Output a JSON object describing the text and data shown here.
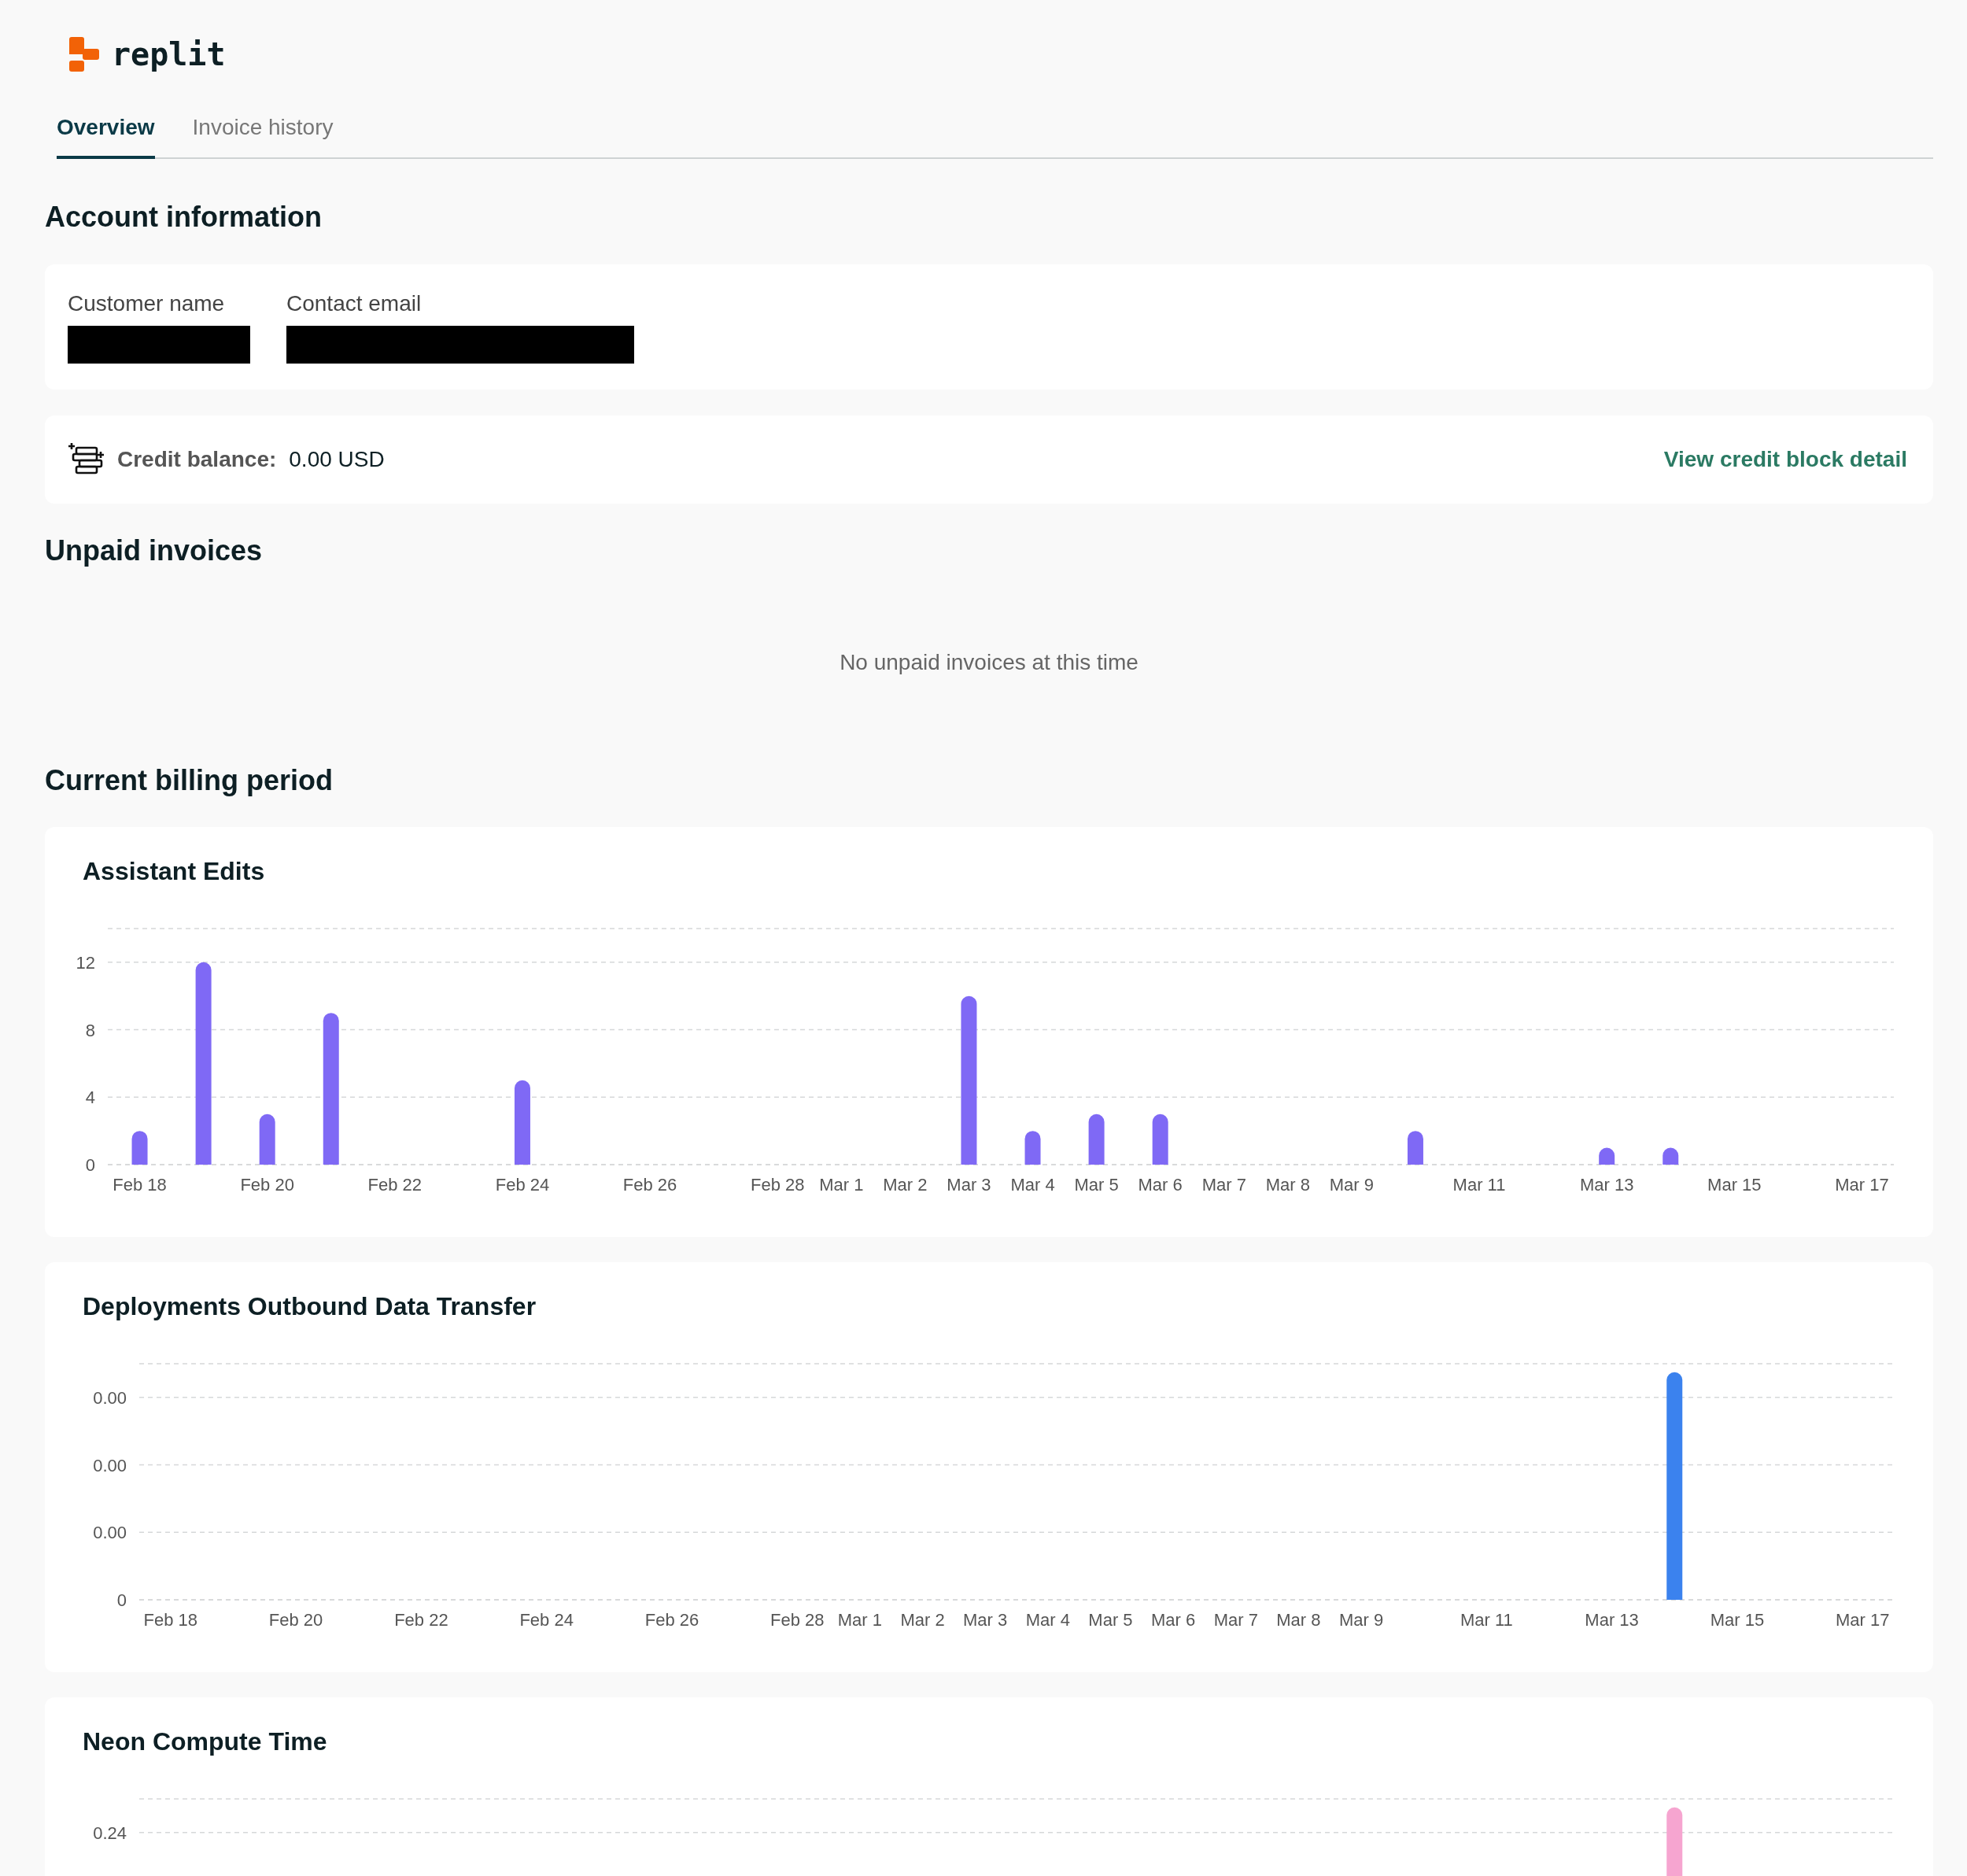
{
  "logo": {
    "wordmark": "replit"
  },
  "tabs": [
    {
      "label": "Overview",
      "selected": true
    },
    {
      "label": "Invoice history",
      "selected": false
    }
  ],
  "account_information": {
    "title": "Account information",
    "fields": [
      {
        "label": "Customer name",
        "value_redacted": true
      },
      {
        "label": "Contact email",
        "value_redacted": true
      }
    ]
  },
  "credit": {
    "label": "Credit balance:",
    "value": "0.00 USD",
    "link": "View credit block detail"
  },
  "unpaid_invoices": {
    "title": "Unpaid invoices",
    "empty_message": "No unpaid invoices at this time"
  },
  "billing": {
    "title": "Current billing period",
    "charts": [
      {
        "title": "Assistant Edits",
        "chart_data": {
          "type": "bar",
          "grid": true,
          "ylim": [
            0,
            14
          ],
          "yticks": [
            0,
            4,
            8,
            12
          ],
          "categories": [
            "Feb 18",
            null,
            "Feb 20",
            null,
            "Feb 22",
            null,
            "Feb 24",
            null,
            "Feb 26",
            null,
            "Feb 28",
            "Mar 1",
            "Mar 2",
            "Mar 3",
            "Mar 4",
            "Mar 5",
            "Mar 6",
            "Mar 7",
            "Mar 8",
            "Mar 9",
            null,
            "Mar 11",
            null,
            "Mar 13",
            null,
            "Mar 15",
            null,
            "Mar 17"
          ],
          "series": [
            {
              "color": "#7f69f5",
              "values": [
                2,
                12,
                3,
                9,
                0,
                0,
                5,
                0,
                0,
                0,
                0,
                0,
                0,
                10,
                2,
                3,
                3,
                0,
                0,
                0,
                2,
                0,
                0,
                1,
                1,
                0,
                0,
                0
              ]
            }
          ]
        }
      },
      {
        "title": "Deployments Outbound Data Transfer",
        "color": "#3b82ee",
        "y_labels": [
          "0.00",
          "0.00",
          "0.00",
          "0"
        ],
        "x_labels": [
          "Feb 18",
          "Feb 20",
          "Feb 22",
          "Feb 24",
          "Feb 26",
          "Feb 28",
          "Mar 1",
          "Mar 2",
          "Mar 3",
          "Mar 4",
          "Mar 5",
          "Mar 6",
          "Mar 7",
          "Mar 8",
          "Mar 9",
          "Mar 11",
          "Mar 13",
          "Mar 15",
          "Mar 17"
        ]
      },
      {
        "title": "Neon Compute Time",
        "color": "#f6a5d0",
        "y_labels": [
          "0.24"
        ]
      }
    ]
  }
}
